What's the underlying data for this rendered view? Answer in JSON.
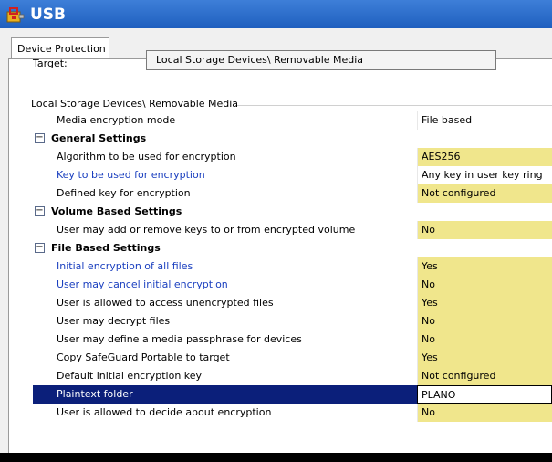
{
  "window": {
    "title": "USB"
  },
  "tabs": [
    {
      "label": "Device Protection"
    }
  ],
  "target": {
    "label": "Target:",
    "value": "Local Storage Devices\\ Removable Media",
    "browse_label": "..."
  },
  "group": {
    "label": "Local Storage Devices\\ Removable Media"
  },
  "grid": {
    "rows": [
      {
        "type": "prop",
        "name": "Media encryption mode",
        "value": "File based",
        "highlight": false,
        "link": false
      },
      {
        "type": "cat",
        "name": "General Settings",
        "expander": "−"
      },
      {
        "type": "prop",
        "name": "Algorithm to be used for encryption",
        "value": "AES256",
        "highlight": true,
        "link": false
      },
      {
        "type": "prop",
        "name": "Key to be used for encryption",
        "value": "Any key in user key ring",
        "highlight": false,
        "link": true
      },
      {
        "type": "prop",
        "name": "Defined key for encryption",
        "value": "Not configured",
        "highlight": true,
        "link": false
      },
      {
        "type": "cat",
        "name": "Volume Based Settings",
        "expander": "−"
      },
      {
        "type": "prop",
        "name": "User may add or remove keys to or from encrypted volume",
        "value": "No",
        "highlight": true,
        "link": false
      },
      {
        "type": "cat",
        "name": "File Based Settings",
        "expander": "−"
      },
      {
        "type": "prop",
        "name": "Initial encryption of all files",
        "value": "Yes",
        "highlight": true,
        "link": true
      },
      {
        "type": "prop",
        "name": "User may cancel initial encryption",
        "value": "No",
        "highlight": true,
        "link": true
      },
      {
        "type": "prop",
        "name": "User is allowed to access unencrypted files",
        "value": "Yes",
        "highlight": true,
        "link": false
      },
      {
        "type": "prop",
        "name": "User may decrypt files",
        "value": "No",
        "highlight": true,
        "link": false
      },
      {
        "type": "prop",
        "name": "User may define a media passphrase for devices",
        "value": "No",
        "highlight": true,
        "link": false
      },
      {
        "type": "prop",
        "name": "Copy SafeGuard Portable to target",
        "value": "Yes",
        "highlight": true,
        "link": false
      },
      {
        "type": "prop",
        "name": "Default initial encryption key",
        "value": "Not configured",
        "highlight": true,
        "link": false
      },
      {
        "type": "prop",
        "name": "Plaintext folder",
        "value": "PLANO",
        "highlight": false,
        "link": false,
        "selected": true
      },
      {
        "type": "prop",
        "name": "User is allowed to decide about encryption",
        "value": "No",
        "highlight": true,
        "link": false
      }
    ]
  },
  "colors": {
    "titlebar": "#1f5fbf",
    "highlight": "#f0e68c",
    "selected": "#0b1f7a",
    "link": "#1a3fbf"
  }
}
